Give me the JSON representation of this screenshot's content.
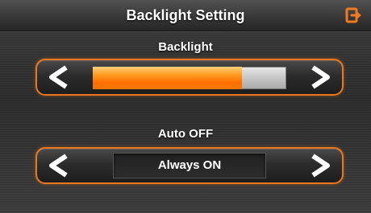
{
  "header": {
    "title": "Backlight Setting",
    "exit_icon": "exit-icon"
  },
  "backlight": {
    "label": "Backlight",
    "level_fraction": 0.77,
    "decrease_icon": "chevron-left-icon",
    "increase_icon": "chevron-right-icon"
  },
  "auto_off": {
    "label": "Auto OFF",
    "value": "Always ON",
    "previous_icon": "chevron-left-icon",
    "next_icon": "chevron-right-icon"
  },
  "colors": {
    "accent": "#e8781e",
    "fill": "#ff7a00",
    "text": "#ffffff"
  }
}
